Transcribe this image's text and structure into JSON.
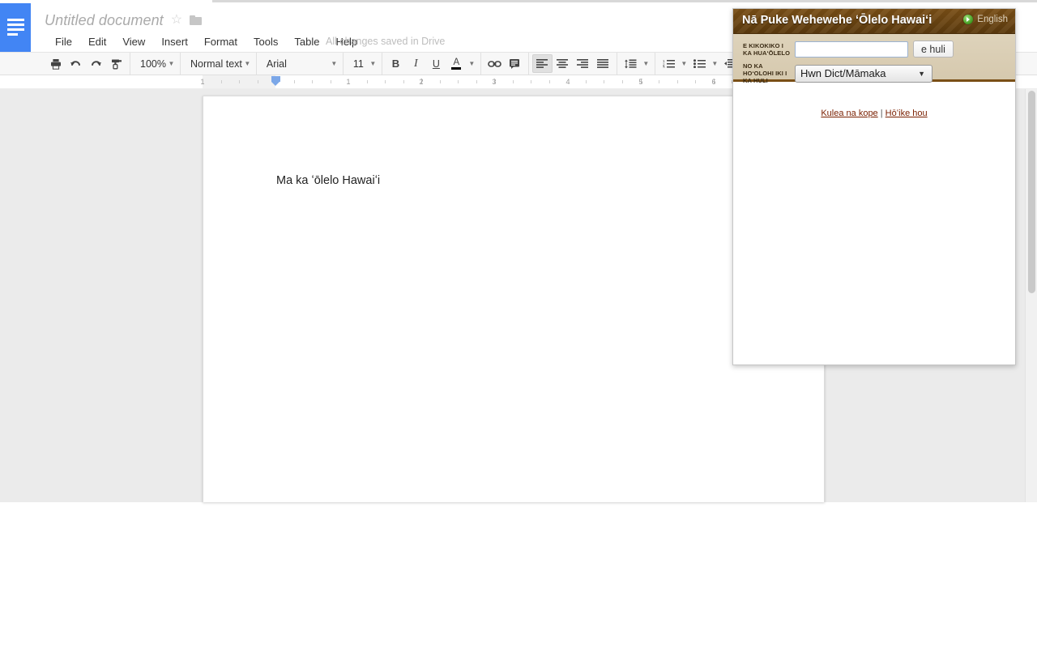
{
  "app": {
    "logo_icon": "docs-lines-icon",
    "doc_title": "Untitled document",
    "star_icon": "star-outline-icon",
    "folder_icon": "folder-icon",
    "save_status": "All changes saved in Drive"
  },
  "menubar": {
    "items": [
      {
        "label": "File"
      },
      {
        "label": "Edit"
      },
      {
        "label": "View"
      },
      {
        "label": "Insert"
      },
      {
        "label": "Format"
      },
      {
        "label": "Tools"
      },
      {
        "label": "Table"
      },
      {
        "label": "Help"
      }
    ]
  },
  "toolbar": {
    "print_icon": "printer-icon",
    "undo_icon": "undo-arrow-icon",
    "redo_icon": "redo-arrow-icon",
    "paint_format_icon": "paint-roller-icon",
    "zoom_value": "100%",
    "style_value": "Normal text",
    "font_value": "Arial",
    "font_size_value": "11",
    "bold_label": "B",
    "italic_label": "I",
    "underline_label": "U",
    "text_color_label": "A",
    "link_icon": "link-icon",
    "comment_icon": "comment-icon",
    "align_left_icon": "align-left-icon",
    "align_center_icon": "align-center-icon",
    "align_right_icon": "align-right-icon",
    "align_justify_icon": "align-justify-icon",
    "line_spacing_icon": "line-spacing-icon",
    "numbered_list_icon": "numbered-list-icon",
    "bulleted_list_icon": "bulleted-list-icon",
    "indent_icon": "indent-icon",
    "caret_icon": "chevron-down-icon"
  },
  "ruler": {
    "numbers": [
      "1",
      "1",
      "2",
      "3",
      "4",
      "5",
      "6"
    ],
    "indent_marker_icon": "indent-marker-icon"
  },
  "document": {
    "body_text": "Ma ka ʻōlelo Hawaiʻi"
  },
  "scrollbar": {
    "thumb_icon": "vertical-scrollbar-thumb"
  },
  "dictionary_popup": {
    "title": "Nā Puke Wehewehe ʻŌlelo Hawaiʻi",
    "lang_toggle_icon": "green-play-icon",
    "lang_toggle_label": "English",
    "word_label": "E KIKOKIKO I KA HUAʻŌLELO",
    "word_value": "",
    "word_placeholder": "",
    "search_button": "e huli",
    "dict_label": "NO KA HOʻOLOHI IKI I KA HULI",
    "dict_selected": "Hwn Dict/Māmaka",
    "dict_options": [
      "Hwn Dict/Māmaka"
    ],
    "dict_caret_icon": "chevron-down-icon",
    "footer_link_1": "Kulea na kope",
    "footer_separator": "|",
    "footer_link_2": "Hōʻike hou"
  },
  "colors": {
    "docs_blue": "#4285f4",
    "header_brown": "#5c3a0e",
    "panel_tan": "#ded3bb",
    "link_red": "#7a1f00"
  }
}
